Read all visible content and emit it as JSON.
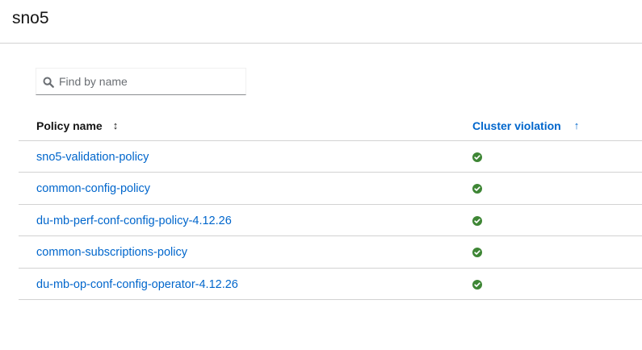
{
  "header": {
    "title": "sno5"
  },
  "search": {
    "placeholder": "Find by name",
    "value": ""
  },
  "table": {
    "columns": [
      {
        "label": "Policy name",
        "sort_icon": "sort-both-icon"
      },
      {
        "label": "Cluster violation",
        "sort_icon": "sort-ascending-icon"
      }
    ],
    "rows": [
      {
        "policy_name": "sno5-validation-policy",
        "status": "compliant"
      },
      {
        "policy_name": "common-config-policy",
        "status": "compliant"
      },
      {
        "policy_name": "du-mb-perf-conf-config-policy-4.12.26",
        "status": "compliant"
      },
      {
        "policy_name": "common-subscriptions-policy",
        "status": "compliant"
      },
      {
        "policy_name": "du-mb-op-conf-config-operator-4.12.26",
        "status": "compliant"
      }
    ]
  },
  "colors": {
    "link": "#0066cc",
    "success": "#3e8635",
    "border": "#d2d2d2"
  }
}
